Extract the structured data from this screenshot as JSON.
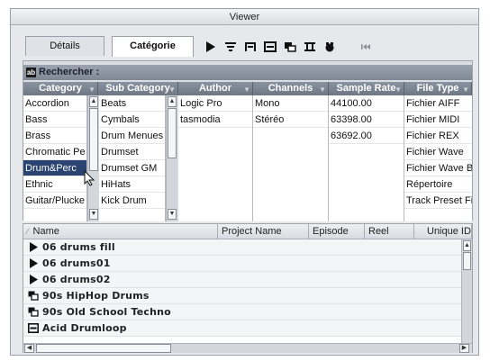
{
  "window": {
    "title": "Viewer"
  },
  "tabs": [
    {
      "label": "Détails",
      "active": false
    },
    {
      "label": "Catégorie",
      "active": true
    }
  ],
  "toolbar": {
    "icons": [
      "play-icon",
      "list-filter-icon",
      "bracket-region-icon",
      "list-icon",
      "nested-windows-icon",
      "ruler-icon",
      "record-camera-icon",
      "rewind-icon"
    ]
  },
  "search": {
    "label": "Rechercher :",
    "icon": "search-box-icon"
  },
  "columns": [
    {
      "title": "Category",
      "items": [
        "Accordion",
        "Bass",
        "Brass",
        "Chromatic Pe",
        "Drum&Perc",
        "Ethnic",
        "Guitar/Plucke"
      ],
      "selected": 4
    },
    {
      "title": "Sub Category",
      "items": [
        "Beats",
        "Cymbals",
        "Drum Menues",
        "Drumset",
        "Drumset GM",
        "HiHats",
        "Kick Drum"
      ],
      "selected": -1
    },
    {
      "title": "Author",
      "items": [
        "Logic Pro",
        "tasmodia"
      ],
      "selected": -1
    },
    {
      "title": "Channels",
      "items": [
        "Mono",
        "Stéréo"
      ],
      "selected": -1
    },
    {
      "title": "Sample Rate",
      "items": [
        "44100.00",
        "63398.00",
        "63692.00"
      ],
      "selected": -1
    },
    {
      "title": "File Type",
      "items": [
        "Fichier AIFF",
        "Fichier MIDI",
        "Fichier REX",
        "Fichier Wave",
        "Fichier Wave Br",
        "Répertoire",
        "Track Preset Fil"
      ],
      "selected": -1
    }
  ],
  "results": {
    "headers": [
      "Name",
      "Project Name",
      "Episode",
      "Reel",
      "Unique ID"
    ],
    "rows": [
      {
        "icon": "play-icon",
        "name": "06 drums fill"
      },
      {
        "icon": "play-icon",
        "name": "06 drums01"
      },
      {
        "icon": "play-icon",
        "name": "06 drums02"
      },
      {
        "icon": "nested-windows-icon",
        "name": "90s HipHop Drums"
      },
      {
        "icon": "nested-windows-icon",
        "name": "90s Old School Techno"
      },
      {
        "icon": "list-icon",
        "name": "Acid Drumloop"
      }
    ]
  },
  "colors": {
    "selection": "#2a4370",
    "header": "#7c8591",
    "background": "#e6e8ec"
  }
}
